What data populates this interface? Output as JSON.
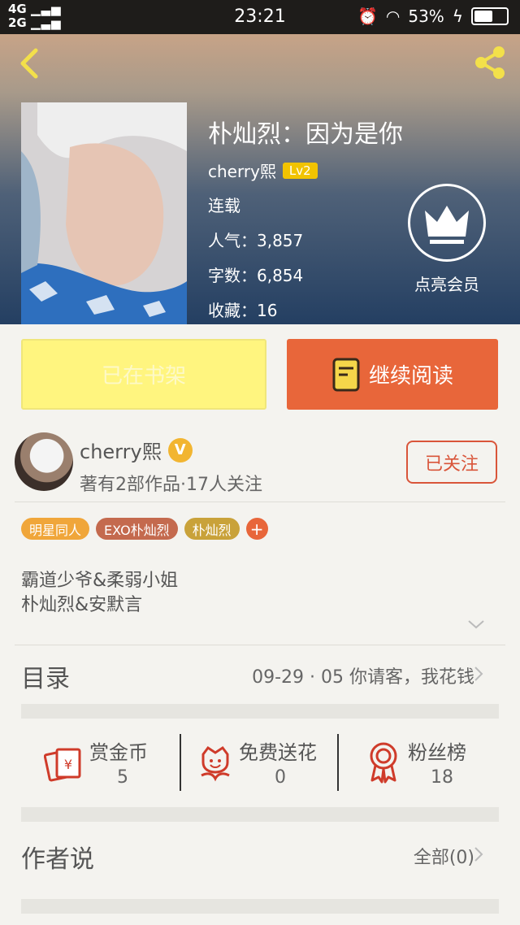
{
  "status_bar": {
    "network_top": "4G",
    "network_bottom": "2G",
    "time": "23:21",
    "battery": "53%"
  },
  "book": {
    "title": "朴灿烈：因为是你",
    "author": "cherry熙",
    "level": "Lv2",
    "status": "连载",
    "popularity_label": "人气：",
    "popularity": "3,857",
    "words_label": "字数：",
    "words": "6,854",
    "favorites_label": "收藏：",
    "favorites": "16"
  },
  "vip": {
    "label": "点亮会员"
  },
  "actions": {
    "shelf_label": "已在书架",
    "read_label": "继续阅读"
  },
  "author_card": {
    "name": "cherry熙",
    "verified_badge": "V",
    "stats": "著有2部作品·17人关注",
    "follow_label": "已关注"
  },
  "tags": [
    {
      "label": "明星同人",
      "color": "#f0a63a"
    },
    {
      "label": "EXO朴灿烈",
      "color": "#c46a4e"
    },
    {
      "label": "朴灿烈",
      "color": "#c9a23a"
    }
  ],
  "tag_add": "+",
  "description": {
    "line1": "霸道少爷&柔弱小姐",
    "line2": "朴灿烈&安默言"
  },
  "toc": {
    "label": "目录",
    "latest": "09-29 · 05 你请客，我花钱"
  },
  "stats": [
    {
      "label": "赏金币",
      "value": "5",
      "icon": "red-envelope-icon"
    },
    {
      "label": "免费送花",
      "value": "0",
      "icon": "flower-icon"
    },
    {
      "label": "粉丝榜",
      "value": "18",
      "icon": "ribbon-icon"
    }
  ],
  "author_says": {
    "label": "作者说",
    "all_label": "全部(0)"
  },
  "colors": {
    "accent_orange": "#e8663a",
    "shelf_yellow": "#fff57f",
    "icon_red": "#cf3b2a"
  }
}
